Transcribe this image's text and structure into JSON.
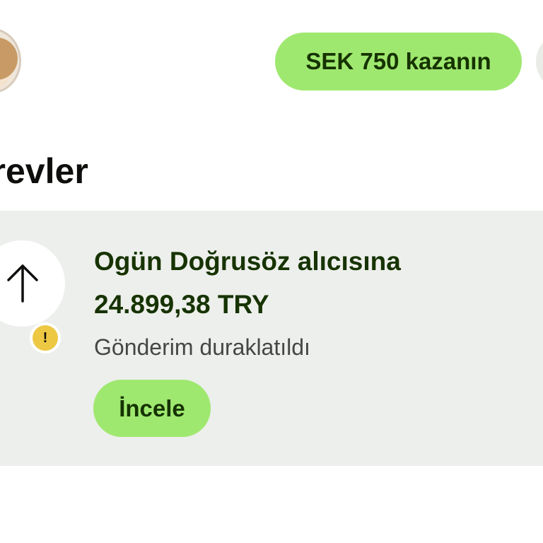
{
  "header": {
    "avatar_icon": "user-avatar",
    "earn_button_label": "SEK 750 kazanın"
  },
  "tasks_section": {
    "title": "örevler"
  },
  "task_card": {
    "icon": "arrow-up-icon",
    "badge_icon": "warning-icon",
    "badge_text": "!",
    "title": "Ogün Doğrusöz alıcısına",
    "amount": "24.899,38 TRY",
    "status": "Gönderim duraklatıldı",
    "action_label": "İncele"
  },
  "colors": {
    "accent_green": "#9fe870",
    "dark_green_text": "#163300",
    "card_background": "#edefec",
    "warning_yellow": "#edc843",
    "muted_text": "#454745"
  }
}
